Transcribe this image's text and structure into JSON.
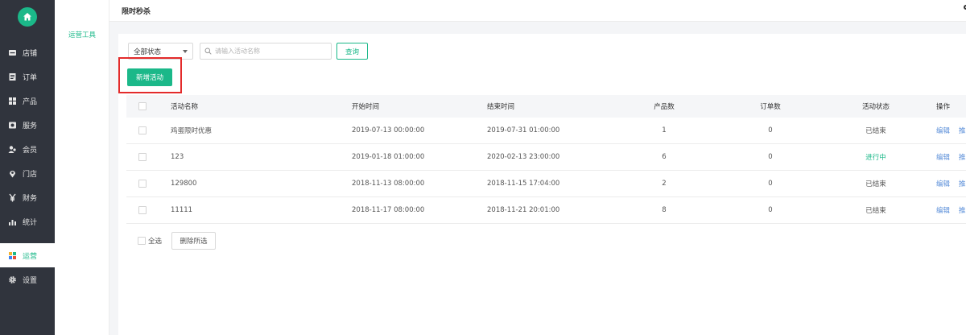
{
  "sidebar": {
    "home_icon": "home-icon",
    "items": [
      {
        "label": "店铺",
        "icon": "store-icon"
      },
      {
        "label": "订单",
        "icon": "order-icon"
      },
      {
        "label": "产品",
        "icon": "grid-icon"
      },
      {
        "label": "服务",
        "icon": "service-icon"
      },
      {
        "label": "会员",
        "icon": "member-icon"
      },
      {
        "label": "门店",
        "icon": "location-icon"
      },
      {
        "label": "财务",
        "icon": "yen-icon"
      },
      {
        "label": "统计",
        "icon": "stats-icon"
      },
      {
        "label": "运营",
        "icon": "operations-icon",
        "active": true
      },
      {
        "label": "设置",
        "icon": "gear-icon"
      }
    ]
  },
  "subsidebar": {
    "item": "运营工具"
  },
  "header": {
    "title": "限时秒杀"
  },
  "filters": {
    "status_value": "全部状态",
    "search_placeholder": "请输入活动名称",
    "query_label": "查询"
  },
  "add_button_label": "新增活动",
  "table": {
    "headers": {
      "name": "活动名称",
      "start": "开始时间",
      "end": "结束时间",
      "products": "产品数",
      "orders": "订单数",
      "status": "活动状态",
      "ops": "操作"
    },
    "rows": [
      {
        "name": "鸡蛋限时优惠",
        "start": "2019-07-13  00:00:00",
        "end": "2019-07-31  01:00:00",
        "products": "1",
        "orders": "0",
        "status": "已结束",
        "edit": "编辑",
        "push": "推"
      },
      {
        "name": "123",
        "start": "2019-01-18  01:00:00",
        "end": "2020-02-13  23:00:00",
        "products": "6",
        "orders": "0",
        "status": "进行中",
        "edit": "编辑",
        "push": "推"
      },
      {
        "name": "129800",
        "start": "2018-11-13  08:00:00",
        "end": "2018-11-15  17:04:00",
        "products": "2",
        "orders": "0",
        "status": "已结束",
        "edit": "编辑",
        "push": "推"
      },
      {
        "name": "11111",
        "start": "2018-11-17  08:00:00",
        "end": "2018-11-21  20:01:00",
        "products": "8",
        "orders": "0",
        "status": "已结束",
        "edit": "编辑",
        "push": "推"
      }
    ]
  },
  "footer": {
    "select_all_label": "全选",
    "delete_selected_label": "删除所选"
  },
  "colors": {
    "accent": "#1bb889",
    "sidebar_bg": "#30343d",
    "highlight": "#e32b2b",
    "link": "#5b8fd9"
  }
}
